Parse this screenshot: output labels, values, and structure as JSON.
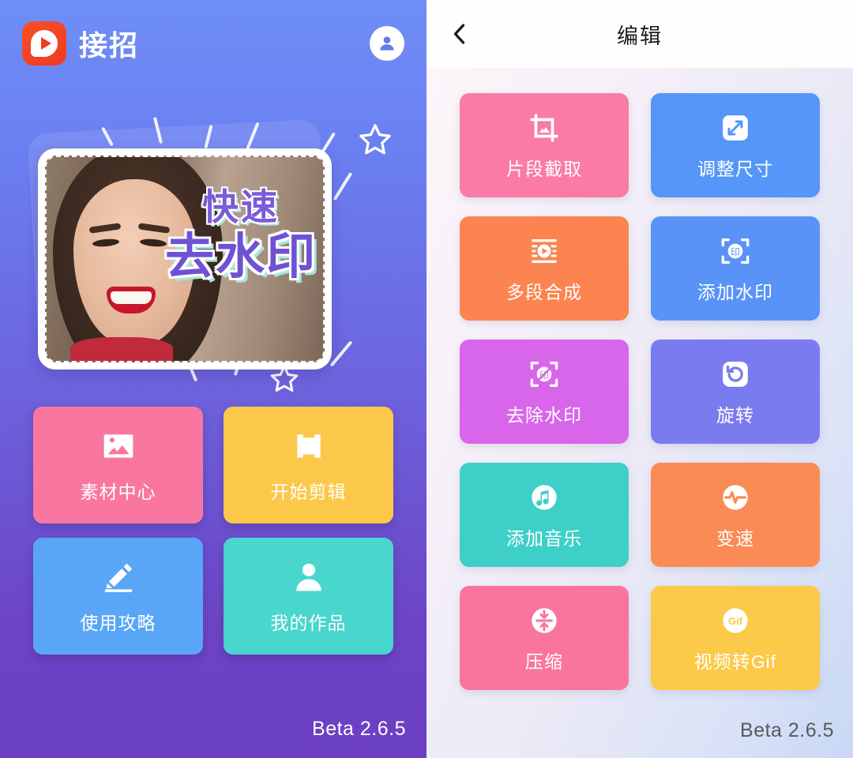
{
  "home": {
    "app_title": "接招",
    "logo_icon": "play-bubble-logo-icon",
    "avatar_icon": "account-avatar-icon",
    "banner": {
      "headline_top": "快速",
      "headline_bottom": "去水印"
    },
    "tiles": [
      {
        "label": "素材中心",
        "color": "#f9779f",
        "icon": "image-picture-icon"
      },
      {
        "label": "开始剪辑",
        "color": "#fbc84a",
        "icon": "star-badge-icon"
      },
      {
        "label": "使用攻略",
        "color": "#59a6f6",
        "icon": "pencil-edit-icon"
      },
      {
        "label": "我的作品",
        "color": "#48d6cd",
        "icon": "person-user-icon"
      }
    ],
    "version": "Beta 2.6.5"
  },
  "edit": {
    "back_icon": "chevron-left-icon",
    "title": "编辑",
    "tiles": [
      {
        "label": "片段截取",
        "color": "#fa7ba3",
        "icon": "crop-frame-icon"
      },
      {
        "label": "调整尺寸",
        "color": "#5596f8",
        "icon": "resize-diagonal-icon"
      },
      {
        "label": "多段合成",
        "color": "#fb8450",
        "icon": "video-merge-play-icon"
      },
      {
        "label": "添加水印",
        "color": "#5a93f7",
        "icon": "add-watermark-scan-icon"
      },
      {
        "label": "去除水印",
        "color": "#d866ea",
        "icon": "remove-watermark-scan-icon"
      },
      {
        "label": "旋转",
        "color": "#7b7bf0",
        "icon": "rotate-counterclockwise-icon"
      },
      {
        "label": "添加音乐",
        "color": "#3ed0c8",
        "icon": "music-note-icon"
      },
      {
        "label": "变速",
        "color": "#fb8b55",
        "icon": "speed-pulse-icon"
      },
      {
        "label": "压缩",
        "color": "#f9759d",
        "icon": "compress-arrows-icon"
      },
      {
        "label": "视频转Gif",
        "color": "#fcc948",
        "icon": "gif-circle-icon",
        "icon_text": "Gif"
      }
    ],
    "version": "Beta 2.6.5"
  }
}
